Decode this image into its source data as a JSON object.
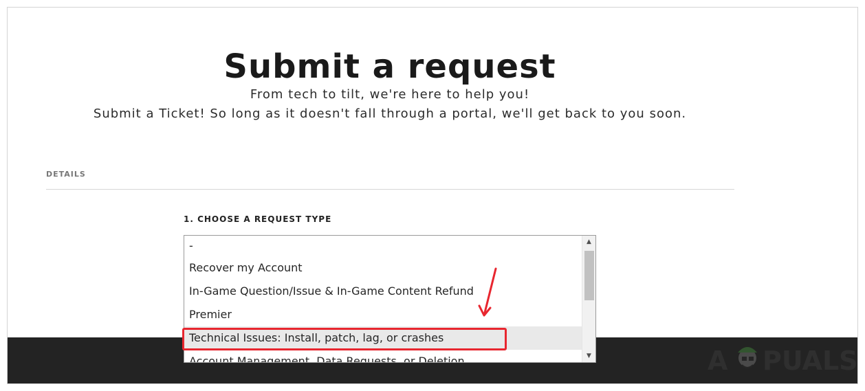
{
  "page": {
    "title": "Submit a request",
    "subtitle_line1": "From tech to tilt, we're here to help you!",
    "subtitle_line2": "Submit a Ticket! So long as it doesn't fall through a portal, we'll get back to you soon."
  },
  "details": {
    "section_label": "DETAILS",
    "request_type_label": "1. CHOOSE A REQUEST TYPE"
  },
  "request_type_list": {
    "options": [
      "-",
      "Recover my Account",
      "In-Game Question/Issue & In-Game Content Refund",
      "Premier",
      "Technical Issues: Install, patch, lag, or crashes",
      "Account Management, Data Requests, or Deletion"
    ],
    "selected": "Technical Issues: Install, patch, lag, or crashes"
  },
  "annotation": {
    "highlight_color": "#e8262f"
  },
  "watermark": {
    "text": "APPUALS"
  },
  "icons": {
    "scroll_up": "triangle-up-icon",
    "scroll_down": "triangle-down-icon",
    "arrow": "red-arrow-icon"
  }
}
